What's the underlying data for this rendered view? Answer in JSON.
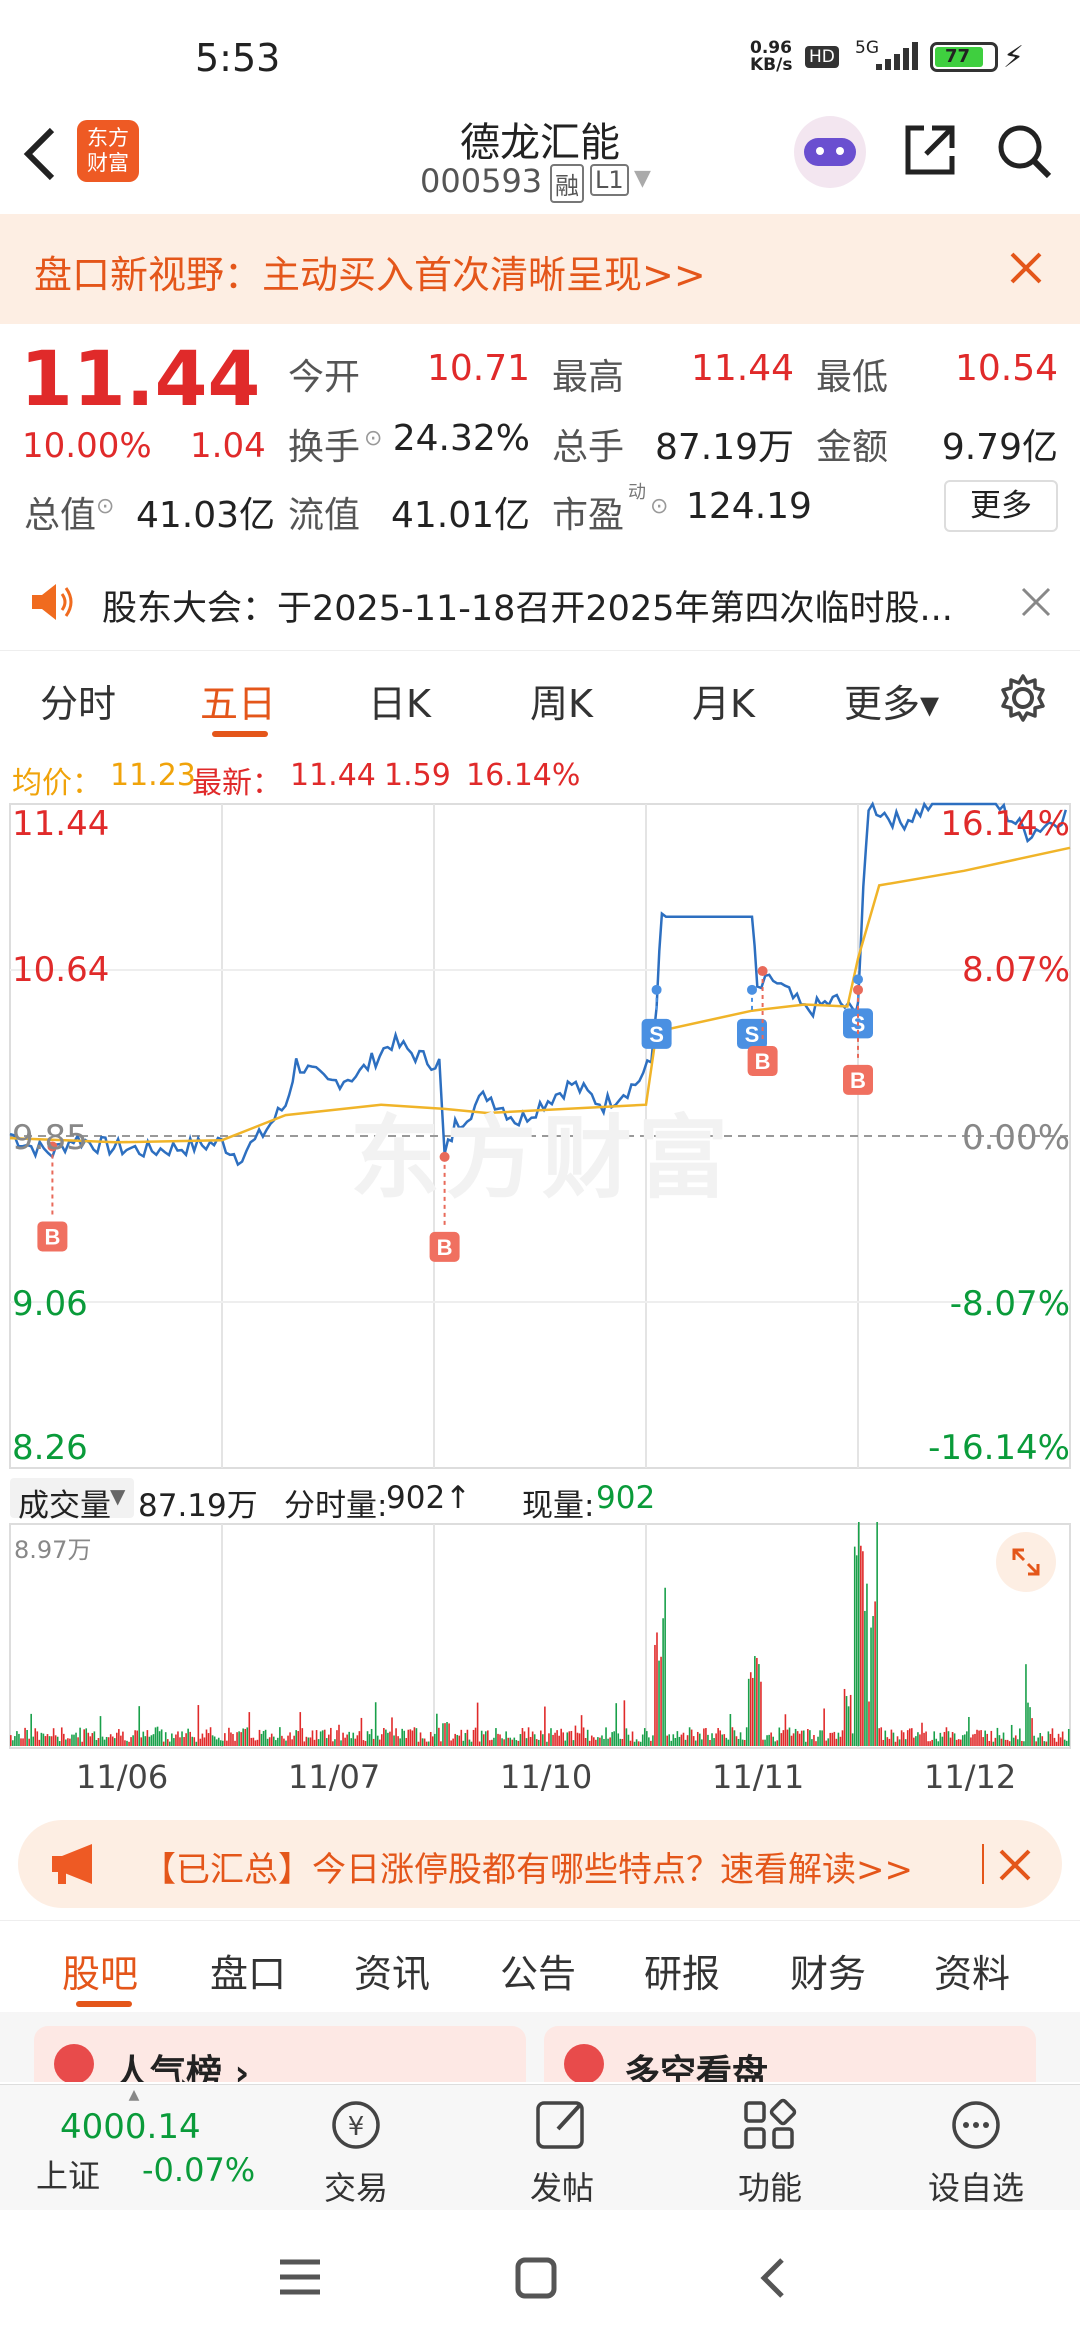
{
  "status_bar": {
    "time": "5:53",
    "net_speed": "0.96\nKB/s",
    "hd": "HD",
    "net": "5G",
    "battery": "77"
  },
  "header": {
    "title": "德龙汇能",
    "code": "000593",
    "badge_rong": "融",
    "badge_level": "L1",
    "logo": "东方\n财富"
  },
  "banner": {
    "text": "盘口新视野：主动买入首次清晰呈现>>"
  },
  "quote": {
    "price": "11.44",
    "change_pct": "10.00%",
    "change": "1.04",
    "open_label": "今开",
    "open": "10.71",
    "high_label": "最高",
    "high": "11.44",
    "low_label": "最低",
    "low": "10.54",
    "turnover_label": "换手",
    "turnover": "24.32%",
    "volume_label": "总手",
    "volume": "87.19万",
    "amount_label": "金额",
    "amount": "9.79亿",
    "mcap_label": "总值",
    "mcap": "41.03亿",
    "float_label": "流值",
    "float": "41.01亿",
    "pe_label": "市盈",
    "pe_sup": "动",
    "pe": "124.19",
    "more": "更多"
  },
  "notice": {
    "text": "股东大会：于2025-11-18召开2025年第四次临时股..."
  },
  "chart_tabs": [
    "分时",
    "五日",
    "日K",
    "周K",
    "月K",
    "更多▾"
  ],
  "avg_line": {
    "avg_label": "均价：",
    "avg": "11.23",
    "last_label": "最新：",
    "last": "11.44",
    "chg": "1.59",
    "chg_pct": "16.14%"
  },
  "chart_data": {
    "type": "line",
    "title": "",
    "y_left": [
      "11.44",
      "10.64",
      "9.85",
      "9.06",
      "8.26"
    ],
    "y_right": [
      "16.14%",
      "8.07%",
      "0.00%",
      "-8.07%",
      "-16.14%"
    ],
    "ylim": [
      8.26,
      11.44
    ],
    "days": [
      "11/06",
      "11/07",
      "11/10",
      "11/11",
      "11/12"
    ],
    "watermark": "东方财富",
    "markers": [
      {
        "label": "B",
        "t": 0.04,
        "price": 9.8
      },
      {
        "label": "B",
        "t": 0.41,
        "price": 9.75
      },
      {
        "label": "S",
        "t": 0.61,
        "price": 10.55
      },
      {
        "label": "S",
        "t": 0.7,
        "price": 10.55
      },
      {
        "label": "B",
        "t": 0.71,
        "price": 10.64
      },
      {
        "label": "S",
        "t": 0.8,
        "price": 10.6
      },
      {
        "label": "B",
        "t": 0.8,
        "price": 10.55
      }
    ]
  },
  "volume": {
    "label": "成交量",
    "total": "87.19万",
    "minute_label": "分时量:",
    "minute": "902↑",
    "now_label": "现量:",
    "now": "902",
    "max": "8.97万"
  },
  "ad": {
    "text": "【已汇总】今日涨停股都有哪些特点？速看解读>>"
  },
  "bottom_tabs": [
    "股吧",
    "盘口",
    "资讯",
    "公告",
    "研报",
    "财务",
    "资料"
  ],
  "cards": [
    "人气榜 ›",
    "多空看盘"
  ],
  "bottom_nav": {
    "index_value": "4000.14",
    "index_name": "上证",
    "index_chg": "-0.07%",
    "items": [
      "交易",
      "发帖",
      "功能",
      "设自选"
    ]
  }
}
